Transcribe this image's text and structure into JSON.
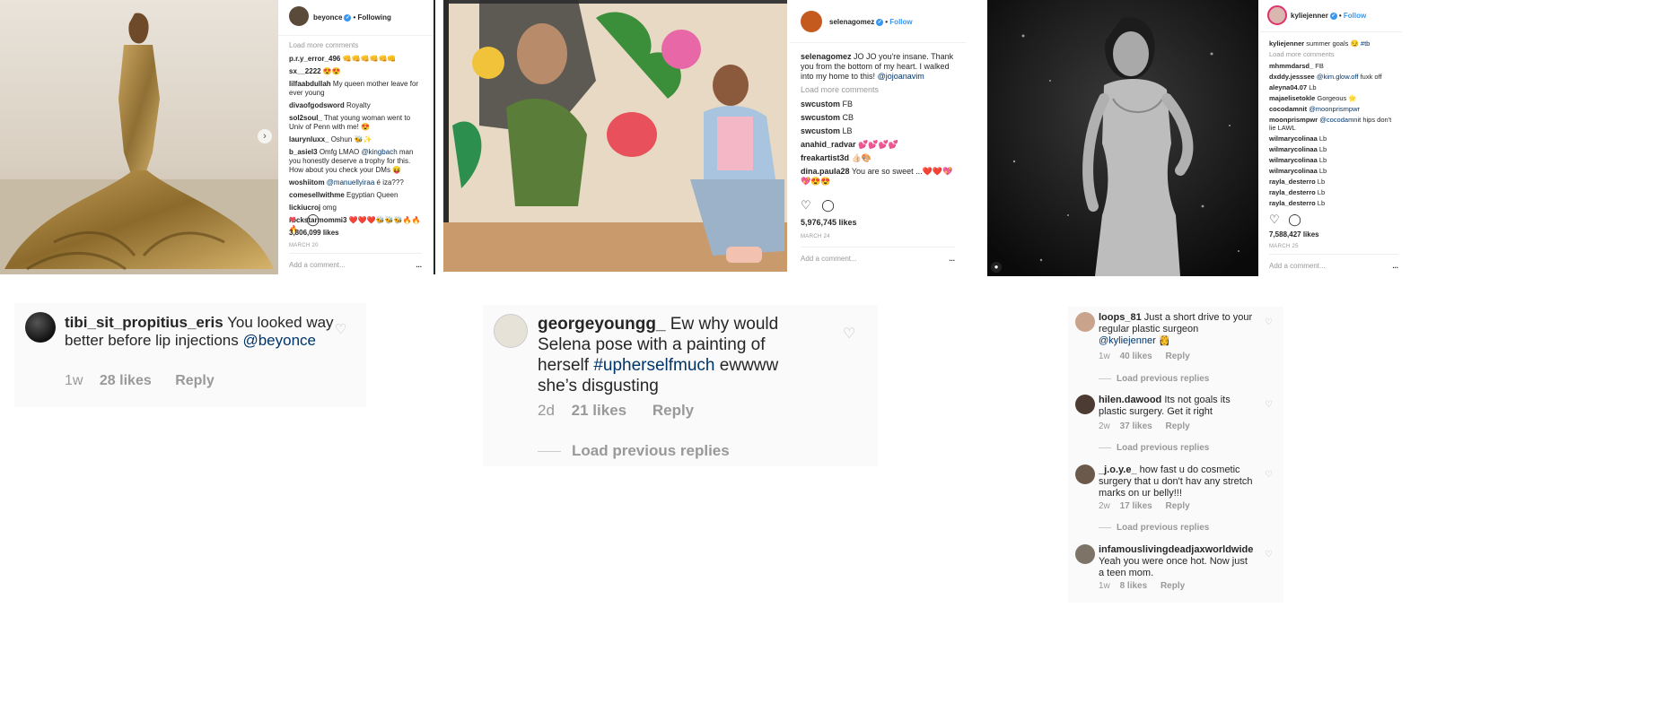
{
  "posts": {
    "beyonce": {
      "username": "beyonce",
      "follow_state": "Following",
      "load_more": "Load more comments",
      "comments": [
        {
          "user": "p.r.y_error_496",
          "text": "👊👊👊👊👊👊"
        },
        {
          "user": "sx__2222",
          "text": "😍😍"
        },
        {
          "user": "lilfaabdullah",
          "text": "My queen mother leave for ever young"
        },
        {
          "user": "divaofgodsword",
          "text": "Royalty"
        },
        {
          "user": "sol2soul_",
          "text": "That young woman went to Univ of Penn with me! 😍"
        },
        {
          "user": "laurynluxx_",
          "text": "Oshun 🐝✨"
        },
        {
          "user": "b_asiel3",
          "text": "Omfg LMAO",
          "mention": "@kingbach",
          "text2": "man you honestly deserve a trophy for this. How about you check your DMs 😝"
        },
        {
          "user": "woshiitom",
          "mention": "@manuellyiraa",
          "text2": "é iza???"
        },
        {
          "user": "comesellwithme",
          "text": "Egyptian Queen"
        },
        {
          "user": "lickiucroj",
          "text": "omg"
        },
        {
          "user": "rockstarmommi3",
          "text": "❤️❤️❤️🐝🐝🐝🔥🔥🔥"
        }
      ],
      "likes": "3,806,099 likes",
      "date": "MARCH 20",
      "add_comment": "Add a comment...",
      "more": "..."
    },
    "selena": {
      "username": "selenagomez",
      "follow_state": "Follow",
      "caption_user": "selenagomez",
      "caption": "JO JO you're insane. Thank you from the bottom of my heart. I walked into my home to this!",
      "caption_mention": "@jojoanavim",
      "load_more": "Load more comments",
      "comments": [
        {
          "user": "swcustom",
          "text": "FB"
        },
        {
          "user": "swcustom",
          "text": "CB"
        },
        {
          "user": "swcustom",
          "text": "LB"
        },
        {
          "user": "anahid_radvar",
          "text": "💕💕💕💕"
        },
        {
          "user": "freakartist3d",
          "text": "👍🏻🎨"
        },
        {
          "user": "dina.paula28",
          "text": "You are so sweet ...❤️❤️💖💖😍😍"
        }
      ],
      "likes": "5,976,745 likes",
      "date": "MARCH 24",
      "add_comment": "Add a comment...",
      "more": "..."
    },
    "kylie": {
      "username": "kyliejenner",
      "follow_state": "Follow",
      "caption_user": "kyliejenner",
      "caption": "summer goals 😏",
      "caption_tag": "#tb",
      "load_more": "Load more comments",
      "comments": [
        {
          "user": "mhmmdarsd_",
          "text": "FB"
        },
        {
          "user": "dxddy.jesssee",
          "mention": "@kim.glow.off",
          "text2": "fuxk off"
        },
        {
          "user": "aleyna04.07",
          "text": "Lb"
        },
        {
          "user": "majaelisetokle",
          "text": "Gorgeous 🌟"
        },
        {
          "user": "cocodamnit",
          "mention": "@moonprismpwr",
          "text2": ""
        },
        {
          "user": "moonprismpwr",
          "mention": "@cocodamnit",
          "text2": "hips don't lie LAWL"
        },
        {
          "user": "wilmarycolinaa",
          "text": "Lb"
        },
        {
          "user": "wilmarycolinaa",
          "text": "Lb"
        },
        {
          "user": "wilmarycolinaa",
          "text": "Lb"
        },
        {
          "user": "wilmarycolinaa",
          "text": "Lb"
        },
        {
          "user": "rayla_desterro",
          "text": "Lb"
        },
        {
          "user": "rayla_desterro",
          "text": "Lb"
        },
        {
          "user": "rayla_desterro",
          "text": "Lb"
        }
      ],
      "likes": "7,588,427 likes",
      "date": "MARCH 25",
      "add_comment": "Add a comment...",
      "more": "..."
    }
  },
  "zoomed": {
    "left": {
      "user": "tibi_sit_propitius_eris",
      "text": "You looked way better before lip injections",
      "mention": "@beyonce",
      "time": "1w",
      "likes": "28 likes",
      "reply": "Reply"
    },
    "middle": {
      "user": "georgeyoungg_",
      "text": "Ew why would Selena pose with a painting of herself",
      "hashtag": "#upherselfmuch",
      "text2": "ewwww she’s disgusting",
      "time": "2d",
      "likes": "21 likes",
      "reply": "Reply",
      "load_previous": "Load previous replies"
    },
    "right": [
      {
        "user": "loops_81",
        "text": "Just a short drive to your regular plastic surgeon",
        "mention": "@kyliejenner",
        "emoji": "👸",
        "time": "1w",
        "likes": "40 likes",
        "reply": "Reply",
        "load_previous": "Load previous replies"
      },
      {
        "user": "hilen.dawood",
        "text": "Its not goals its plastic surgery.  Get it right",
        "time": "2w",
        "likes": "37 likes",
        "reply": "Reply",
        "load_previous": "Load previous replies"
      },
      {
        "user": "_j.o.y.e_",
        "text": "how fast u  do cosmetic surgery that u don't hav any stretch marks on ur belly!!!",
        "time": "2w",
        "likes": "17 likes",
        "reply": "Reply",
        "load_previous": "Load previous replies"
      },
      {
        "user": "infamouslivingdeadjaxworldwide",
        "text": "Yeah you were once hot. Now just a teen mom.",
        "time": "1w",
        "likes": "8 likes",
        "reply": "Reply"
      }
    ]
  },
  "colors": {
    "link": "#003569",
    "hashtag": "#3897f0",
    "liked_heart": "#ed4956",
    "muted": "#999999"
  },
  "icons": [
    "heart-icon",
    "comment-icon",
    "verified-icon",
    "chevron-right-icon",
    "user-tag-icon"
  ]
}
